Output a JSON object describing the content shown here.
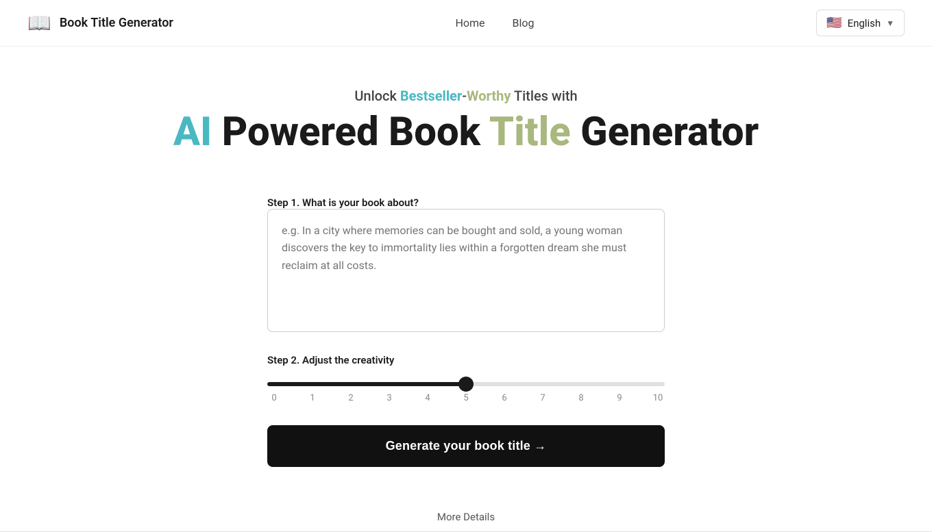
{
  "navbar": {
    "logo_icon": "📖",
    "brand": "Book Title Generator",
    "nav_links": [
      {
        "label": "Home",
        "id": "home"
      },
      {
        "label": "Blog",
        "id": "blog"
      }
    ],
    "language": {
      "flag": "🇺🇸",
      "label": "English",
      "chevron": "▼"
    }
  },
  "hero": {
    "subtitle_prefix": "Unlock ",
    "subtitle_bestseller": "Bestseller",
    "subtitle_hyphen": "-",
    "subtitle_worthy": "Worthy",
    "subtitle_suffix": " Titles with",
    "title_ai": "AI",
    "title_powered": " Powered ",
    "title_book": "Book ",
    "title_title": "Title",
    "title_generator": " Generator"
  },
  "step1": {
    "label": "Step 1. What is your book about?",
    "placeholder": "e.g. In a city where memories can be bought and sold, a young woman discovers the key to immortality lies within a forgotten dream she must reclaim at all costs."
  },
  "step2": {
    "label": "Step 2. Adjust the creativity",
    "slider_min": 0,
    "slider_max": 10,
    "slider_value": 5,
    "slider_ticks": [
      "0",
      "1",
      "2",
      "3",
      "4",
      "5",
      "6",
      "7",
      "8",
      "9",
      "10"
    ]
  },
  "generate_button": {
    "label": "Generate your book title →"
  },
  "more_details": {
    "label": "More Details"
  }
}
